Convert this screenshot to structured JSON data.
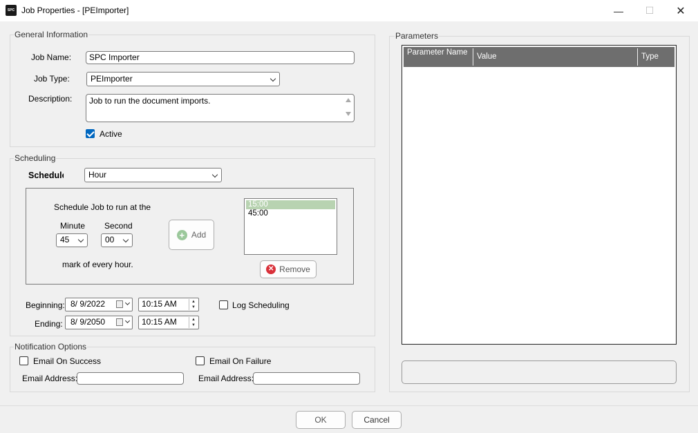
{
  "window": {
    "title": "Job Properties - [PEImporter]",
    "app_icon_text": "SPC"
  },
  "general": {
    "legend": "General Information",
    "job_name_label": "Job Name:",
    "job_name_value": "SPC Importer",
    "job_type_label": "Job Type:",
    "job_type_value": "PEImporter",
    "description_label": "Description:",
    "description_value": "Job to run the document imports.",
    "active_label": "Active",
    "active_checked": true
  },
  "scheduling": {
    "legend": "Scheduling",
    "schedule_label": "Schedule",
    "schedule_value": "Hour",
    "run_at_text": "Schedule Job to run at the",
    "minute_label": "Minute",
    "minute_value": "45",
    "second_label": "Second",
    "second_value": "00",
    "every_hour_text": "mark of every hour.",
    "add_label": "Add",
    "remove_label": "Remove",
    "times": [
      "15:00",
      "45:00"
    ],
    "selected_time_index": 0,
    "beginning_label": "Beginning:",
    "beginning_date": "8/  9/2022",
    "beginning_time": "10:15 AM",
    "ending_label": "Ending:",
    "ending_date": "8/  9/2050",
    "ending_time": "10:15 AM",
    "log_label": "Log Scheduling"
  },
  "notification": {
    "legend": "Notification Options",
    "success_label": "Email On Success",
    "failure_label": "Email On Failure",
    "email_label_1": "Email Address:",
    "email_label_2": "Email Address:"
  },
  "parameters": {
    "legend": "Parameters",
    "columns": [
      "Parameter Name",
      "Value",
      "Type"
    ]
  },
  "footer": {
    "ok_label": "OK",
    "cancel_label": "Cancel"
  }
}
